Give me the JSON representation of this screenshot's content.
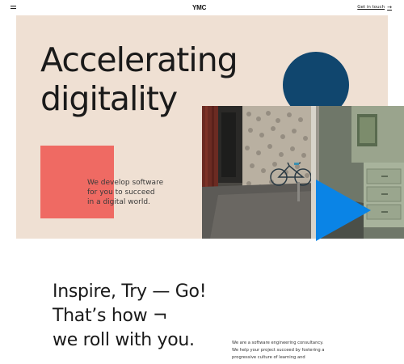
{
  "header": {
    "logo": "YMC",
    "cta_label": "Get in touch",
    "cta_arrow": "→",
    "menu_icon": "hamburger-menu-icon"
  },
  "hero": {
    "title_line1": "Accelerating",
    "title_line2": "digitality",
    "tagline_line1": "We develop software",
    "tagline_line2": "for you to succeed",
    "tagline_line3": "in a digital world."
  },
  "intro": {
    "slogan_line1": "Inspire, Try — Go!",
    "slogan_line2": "That’s how ¬",
    "slogan_line3": "we roll with you.",
    "about_line1": "We are a software engineering consultancy.",
    "about_line2": "We help your project succeed by fostering a",
    "about_line3": "progressive culture of learning and"
  },
  "colors": {
    "hero_background": "#efe0d3",
    "circle": "#10466e",
    "square": "#ef6a63",
    "triangle": "#0a84e6"
  }
}
